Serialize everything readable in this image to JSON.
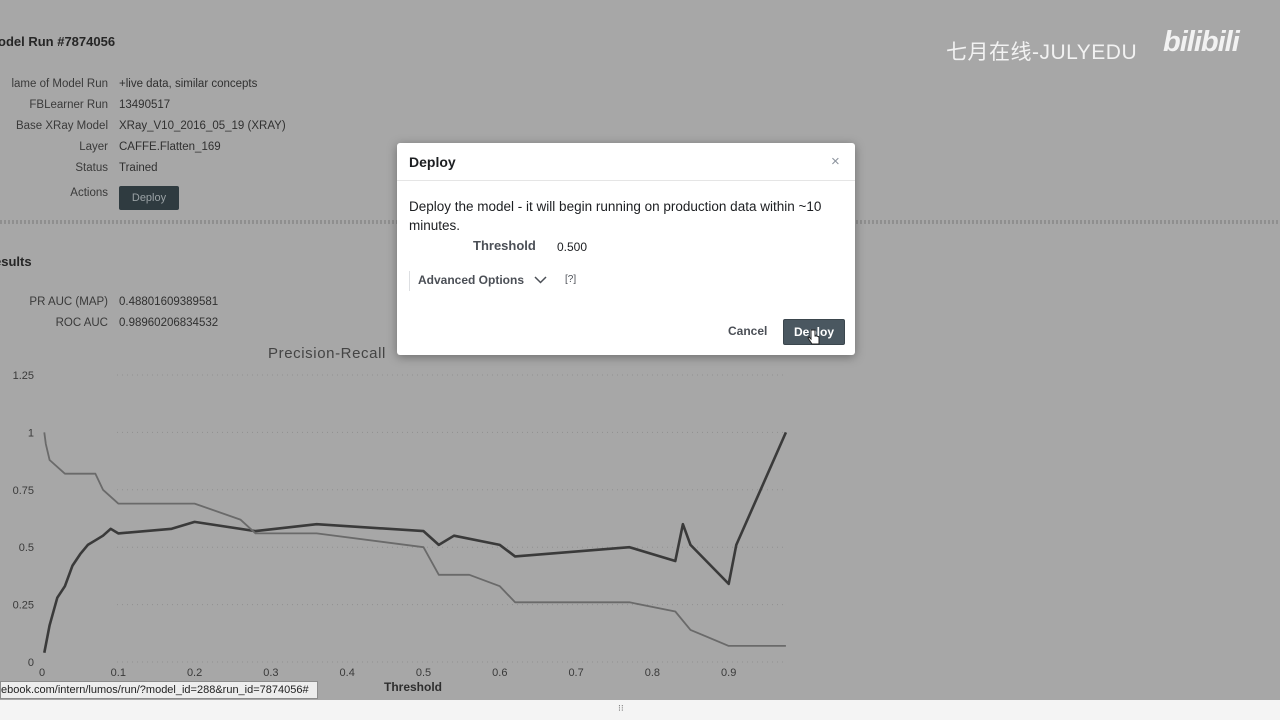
{
  "watermark": {
    "text": "七月在线-JULYEDU",
    "logo": "bilibili"
  },
  "run": {
    "title": "odel Run #7874056",
    "fields": [
      {
        "label": "lame of Model Run",
        "value": "+live data, similar concepts"
      },
      {
        "label": "FBLearner Run",
        "value": "13490517"
      },
      {
        "label": "Base XRay Model",
        "value": "XRay_V10_2016_05_19 (XRAY)"
      },
      {
        "label": "Layer",
        "value": "CAFFE.Flatten_169"
      },
      {
        "label": "Status",
        "value": "Trained"
      }
    ],
    "actions_label": "Actions",
    "deploy_label": "Deploy"
  },
  "results": {
    "title": "esults",
    "metrics": [
      {
        "label": "PR AUC (MAP)",
        "value": "0.48801609389581"
      },
      {
        "label": "ROC AUC",
        "value": "0.98960206834532"
      }
    ]
  },
  "chart_data": {
    "type": "line",
    "title": "Precision-Recall",
    "xlabel": "Threshold",
    "xlim": [
      0,
      0.98
    ],
    "ylim": [
      0,
      1.25
    ],
    "y_ticks": [
      "0",
      "0.25",
      "0.5",
      "0.75",
      "1",
      "1.25"
    ],
    "x_ticks": [
      "0",
      "0.1",
      "0.2",
      "0.3",
      "0.4",
      "0.5",
      "0.6",
      "0.7",
      "0.8",
      "0.9"
    ],
    "series": [
      {
        "color": "#3a3a3a",
        "points": [
          [
            0.003,
            0.04
          ],
          [
            0.01,
            0.16
          ],
          [
            0.02,
            0.28
          ],
          [
            0.03,
            0.33
          ],
          [
            0.04,
            0.42
          ],
          [
            0.05,
            0.47
          ],
          [
            0.06,
            0.51
          ],
          [
            0.07,
            0.53
          ],
          [
            0.08,
            0.55
          ],
          [
            0.09,
            0.58
          ],
          [
            0.1,
            0.56
          ],
          [
            0.17,
            0.58
          ],
          [
            0.2,
            0.61
          ],
          [
            0.28,
            0.57
          ],
          [
            0.36,
            0.6
          ],
          [
            0.5,
            0.57
          ],
          [
            0.52,
            0.51
          ],
          [
            0.54,
            0.55
          ],
          [
            0.6,
            0.51
          ],
          [
            0.62,
            0.46
          ],
          [
            0.77,
            0.5
          ],
          [
            0.83,
            0.44
          ],
          [
            0.84,
            0.6
          ],
          [
            0.85,
            0.51
          ],
          [
            0.9,
            0.34
          ],
          [
            0.91,
            0.51
          ],
          [
            0.975,
            1.0
          ]
        ]
      },
      {
        "color": "#6a6a6a",
        "points": [
          [
            0.003,
            1.0
          ],
          [
            0.005,
            0.95
          ],
          [
            0.01,
            0.88
          ],
          [
            0.03,
            0.82
          ],
          [
            0.07,
            0.82
          ],
          [
            0.08,
            0.75
          ],
          [
            0.1,
            0.69
          ],
          [
            0.2,
            0.69
          ],
          [
            0.26,
            0.62
          ],
          [
            0.28,
            0.56
          ],
          [
            0.36,
            0.56
          ],
          [
            0.5,
            0.5
          ],
          [
            0.52,
            0.38
          ],
          [
            0.56,
            0.38
          ],
          [
            0.6,
            0.33
          ],
          [
            0.62,
            0.26
          ],
          [
            0.77,
            0.26
          ],
          [
            0.83,
            0.22
          ],
          [
            0.85,
            0.14
          ],
          [
            0.9,
            0.07
          ],
          [
            0.975,
            0.07
          ]
        ]
      }
    ]
  },
  "status_url": "ebook.com/intern/lumos/run/?model_id=288&run_id=7874056#",
  "modal": {
    "title": "Deploy",
    "description": "Deploy the model - it will begin running on production data within ~10 minutes.",
    "threshold_label": "Threshold",
    "threshold_value": "0.500",
    "advanced_label": "Advanced Options",
    "help_label": "[?]",
    "cancel_label": "Cancel",
    "deploy_label": "Deploy"
  }
}
